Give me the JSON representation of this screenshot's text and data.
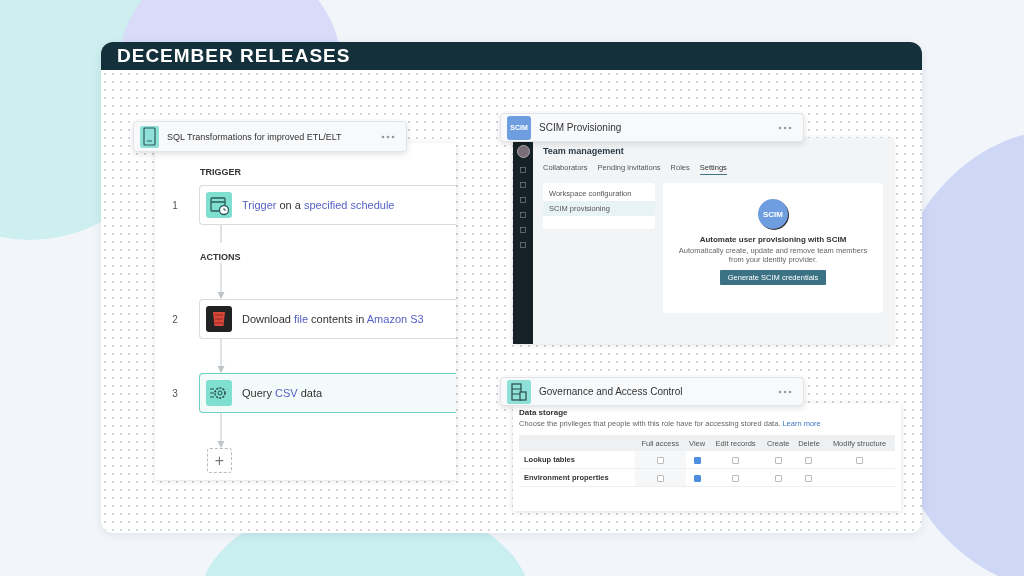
{
  "banner": {
    "title": "DECEMBER RELEASES"
  },
  "workflow": {
    "title": "SQL Transformations for improved ETL/ELT",
    "sections": [
      {
        "label": "TRIGGER",
        "steps": [
          {
            "number": "1",
            "kind": "schedule",
            "selected": false,
            "parts": [
              {
                "text": "Trigger",
                "highlight": true
              },
              {
                "text": " on a ",
                "highlight": false
              },
              {
                "text": "specified schedule",
                "highlight": true
              }
            ]
          }
        ]
      },
      {
        "label": "ACTIONS",
        "steps": [
          {
            "number": "2",
            "kind": "storage",
            "selected": false,
            "parts": [
              {
                "text": "Download ",
                "highlight": false
              },
              {
                "text": "file",
                "highlight": true
              },
              {
                "text": " contents in ",
                "highlight": false
              },
              {
                "text": "Amazon S3",
                "highlight": true
              }
            ]
          },
          {
            "number": "3",
            "kind": "gear",
            "selected": true,
            "parts": [
              {
                "text": "Query ",
                "highlight": false
              },
              {
                "text": "CSV",
                "highlight": true
              },
              {
                "text": " data",
                "highlight": false
              }
            ]
          }
        ]
      }
    ],
    "add_button": "+"
  },
  "scim": {
    "title": "SCIM Provisioning",
    "badge": "SCIM",
    "page_title": "Team management",
    "tabs": [
      {
        "label": "Collaborators",
        "selected": false
      },
      {
        "label": "Pending invitations",
        "selected": false
      },
      {
        "label": "Roles",
        "selected": false
      },
      {
        "label": "Settings",
        "selected": true
      }
    ],
    "menu": [
      {
        "label": "Workspace configuration",
        "selected": false
      },
      {
        "label": "SCIM provisioning",
        "selected": true
      }
    ],
    "empty_state": {
      "badge": "SCIM",
      "heading": "Automate user provisioning with SCIM",
      "description": "Automatically create, update and remove team members from your identity provider.",
      "button": "Generate SCIM credentials"
    }
  },
  "governance": {
    "title": "Governance and Access Control",
    "section_title": "Data storage",
    "description": "Choose the privileges that people with this role have for accessing stored data.",
    "link": "Learn more",
    "columns": [
      "Full access",
      "View",
      "Edit records",
      "Create",
      "Delete",
      "Modify structure"
    ],
    "rows": [
      {
        "label": "Lookup tables",
        "permissions": [
          {
            "checked": false
          },
          {
            "checked": true
          },
          {
            "checked": false
          },
          {
            "checked": false
          },
          {
            "checked": false
          },
          {
            "checked": false
          }
        ]
      },
      {
        "label": "Environment properties",
        "permissions": [
          {
            "checked": false
          },
          {
            "checked": true
          },
          {
            "checked": false
          },
          {
            "checked": false
          },
          {
            "checked": false
          }
        ]
      }
    ]
  }
}
